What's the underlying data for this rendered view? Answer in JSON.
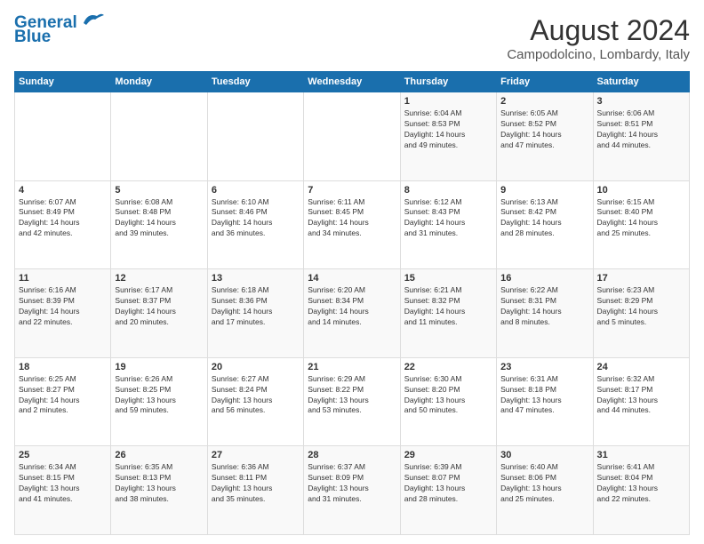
{
  "header": {
    "logo_line1": "General",
    "logo_line2": "Blue",
    "title": "August 2024",
    "subtitle": "Campodolcino, Lombardy, Italy"
  },
  "weekdays": [
    "Sunday",
    "Monday",
    "Tuesday",
    "Wednesday",
    "Thursday",
    "Friday",
    "Saturday"
  ],
  "weeks": [
    [
      {
        "day": "",
        "info": ""
      },
      {
        "day": "",
        "info": ""
      },
      {
        "day": "",
        "info": ""
      },
      {
        "day": "",
        "info": ""
      },
      {
        "day": "1",
        "info": "Sunrise: 6:04 AM\nSunset: 8:53 PM\nDaylight: 14 hours\nand 49 minutes."
      },
      {
        "day": "2",
        "info": "Sunrise: 6:05 AM\nSunset: 8:52 PM\nDaylight: 14 hours\nand 47 minutes."
      },
      {
        "day": "3",
        "info": "Sunrise: 6:06 AM\nSunset: 8:51 PM\nDaylight: 14 hours\nand 44 minutes."
      }
    ],
    [
      {
        "day": "4",
        "info": "Sunrise: 6:07 AM\nSunset: 8:49 PM\nDaylight: 14 hours\nand 42 minutes."
      },
      {
        "day": "5",
        "info": "Sunrise: 6:08 AM\nSunset: 8:48 PM\nDaylight: 14 hours\nand 39 minutes."
      },
      {
        "day": "6",
        "info": "Sunrise: 6:10 AM\nSunset: 8:46 PM\nDaylight: 14 hours\nand 36 minutes."
      },
      {
        "day": "7",
        "info": "Sunrise: 6:11 AM\nSunset: 8:45 PM\nDaylight: 14 hours\nand 34 minutes."
      },
      {
        "day": "8",
        "info": "Sunrise: 6:12 AM\nSunset: 8:43 PM\nDaylight: 14 hours\nand 31 minutes."
      },
      {
        "day": "9",
        "info": "Sunrise: 6:13 AM\nSunset: 8:42 PM\nDaylight: 14 hours\nand 28 minutes."
      },
      {
        "day": "10",
        "info": "Sunrise: 6:15 AM\nSunset: 8:40 PM\nDaylight: 14 hours\nand 25 minutes."
      }
    ],
    [
      {
        "day": "11",
        "info": "Sunrise: 6:16 AM\nSunset: 8:39 PM\nDaylight: 14 hours\nand 22 minutes."
      },
      {
        "day": "12",
        "info": "Sunrise: 6:17 AM\nSunset: 8:37 PM\nDaylight: 14 hours\nand 20 minutes."
      },
      {
        "day": "13",
        "info": "Sunrise: 6:18 AM\nSunset: 8:36 PM\nDaylight: 14 hours\nand 17 minutes."
      },
      {
        "day": "14",
        "info": "Sunrise: 6:20 AM\nSunset: 8:34 PM\nDaylight: 14 hours\nand 14 minutes."
      },
      {
        "day": "15",
        "info": "Sunrise: 6:21 AM\nSunset: 8:32 PM\nDaylight: 14 hours\nand 11 minutes."
      },
      {
        "day": "16",
        "info": "Sunrise: 6:22 AM\nSunset: 8:31 PM\nDaylight: 14 hours\nand 8 minutes."
      },
      {
        "day": "17",
        "info": "Sunrise: 6:23 AM\nSunset: 8:29 PM\nDaylight: 14 hours\nand 5 minutes."
      }
    ],
    [
      {
        "day": "18",
        "info": "Sunrise: 6:25 AM\nSunset: 8:27 PM\nDaylight: 14 hours\nand 2 minutes."
      },
      {
        "day": "19",
        "info": "Sunrise: 6:26 AM\nSunset: 8:25 PM\nDaylight: 13 hours\nand 59 minutes."
      },
      {
        "day": "20",
        "info": "Sunrise: 6:27 AM\nSunset: 8:24 PM\nDaylight: 13 hours\nand 56 minutes."
      },
      {
        "day": "21",
        "info": "Sunrise: 6:29 AM\nSunset: 8:22 PM\nDaylight: 13 hours\nand 53 minutes."
      },
      {
        "day": "22",
        "info": "Sunrise: 6:30 AM\nSunset: 8:20 PM\nDaylight: 13 hours\nand 50 minutes."
      },
      {
        "day": "23",
        "info": "Sunrise: 6:31 AM\nSunset: 8:18 PM\nDaylight: 13 hours\nand 47 minutes."
      },
      {
        "day": "24",
        "info": "Sunrise: 6:32 AM\nSunset: 8:17 PM\nDaylight: 13 hours\nand 44 minutes."
      }
    ],
    [
      {
        "day": "25",
        "info": "Sunrise: 6:34 AM\nSunset: 8:15 PM\nDaylight: 13 hours\nand 41 minutes."
      },
      {
        "day": "26",
        "info": "Sunrise: 6:35 AM\nSunset: 8:13 PM\nDaylight: 13 hours\nand 38 minutes."
      },
      {
        "day": "27",
        "info": "Sunrise: 6:36 AM\nSunset: 8:11 PM\nDaylight: 13 hours\nand 35 minutes."
      },
      {
        "day": "28",
        "info": "Sunrise: 6:37 AM\nSunset: 8:09 PM\nDaylight: 13 hours\nand 31 minutes."
      },
      {
        "day": "29",
        "info": "Sunrise: 6:39 AM\nSunset: 8:07 PM\nDaylight: 13 hours\nand 28 minutes."
      },
      {
        "day": "30",
        "info": "Sunrise: 6:40 AM\nSunset: 8:06 PM\nDaylight: 13 hours\nand 25 minutes."
      },
      {
        "day": "31",
        "info": "Sunrise: 6:41 AM\nSunset: 8:04 PM\nDaylight: 13 hours\nand 22 minutes."
      }
    ]
  ]
}
